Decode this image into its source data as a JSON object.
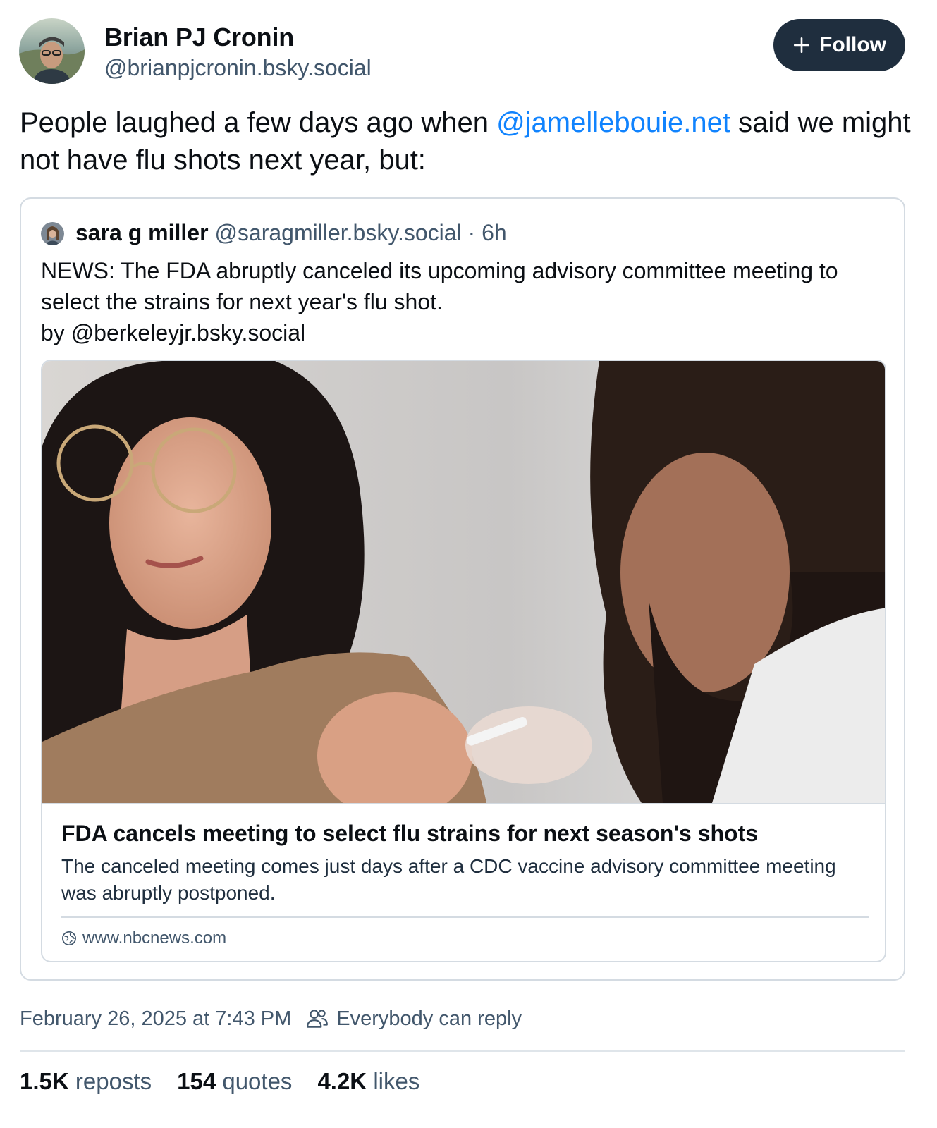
{
  "author": {
    "display_name": "Brian PJ Cronin",
    "handle": "@brianpjcronin.bsky.social",
    "avatar_icon": "user-avatar-photo"
  },
  "follow_button": {
    "label": "Follow",
    "icon": "plus-icon"
  },
  "post": {
    "text_before": "People laughed a few days ago when ",
    "mention": "@jamellebouie.net",
    "text_after": " said we might not have flu shots next year, but:"
  },
  "quote": {
    "author_name": "sara g miller",
    "author_handle": "@saragmiller.bsky.social",
    "time": "· 6h",
    "text_line1": "NEWS: The FDA abruptly canceled its upcoming advisory committee meeting to select the strains for next year's flu shot.",
    "text_line2": "by @berkeleyjr.bsky.social",
    "link_card": {
      "title": "FDA cancels meeting to select flu strains for next season's shots",
      "description": "The canceled meeting comes just days after a CDC vaccine advisory committee meeting was abruptly postponed.",
      "domain": "www.nbcnews.com",
      "domain_icon": "globe-icon"
    }
  },
  "meta": {
    "timestamp": "February 26, 2025 at 7:43 PM",
    "reply_setting": "Everybody can reply",
    "reply_icon": "people-icon"
  },
  "stats": {
    "reposts_count": "1.5K",
    "reposts_label": "reposts",
    "quotes_count": "154",
    "quotes_label": "quotes",
    "likes_count": "4.2K",
    "likes_label": "likes"
  },
  "colors": {
    "text": "#0b0f14",
    "muted": "#42576c",
    "link": "#1083fe",
    "follow_bg": "#1f2e3e",
    "border": "#d4dbe2"
  }
}
